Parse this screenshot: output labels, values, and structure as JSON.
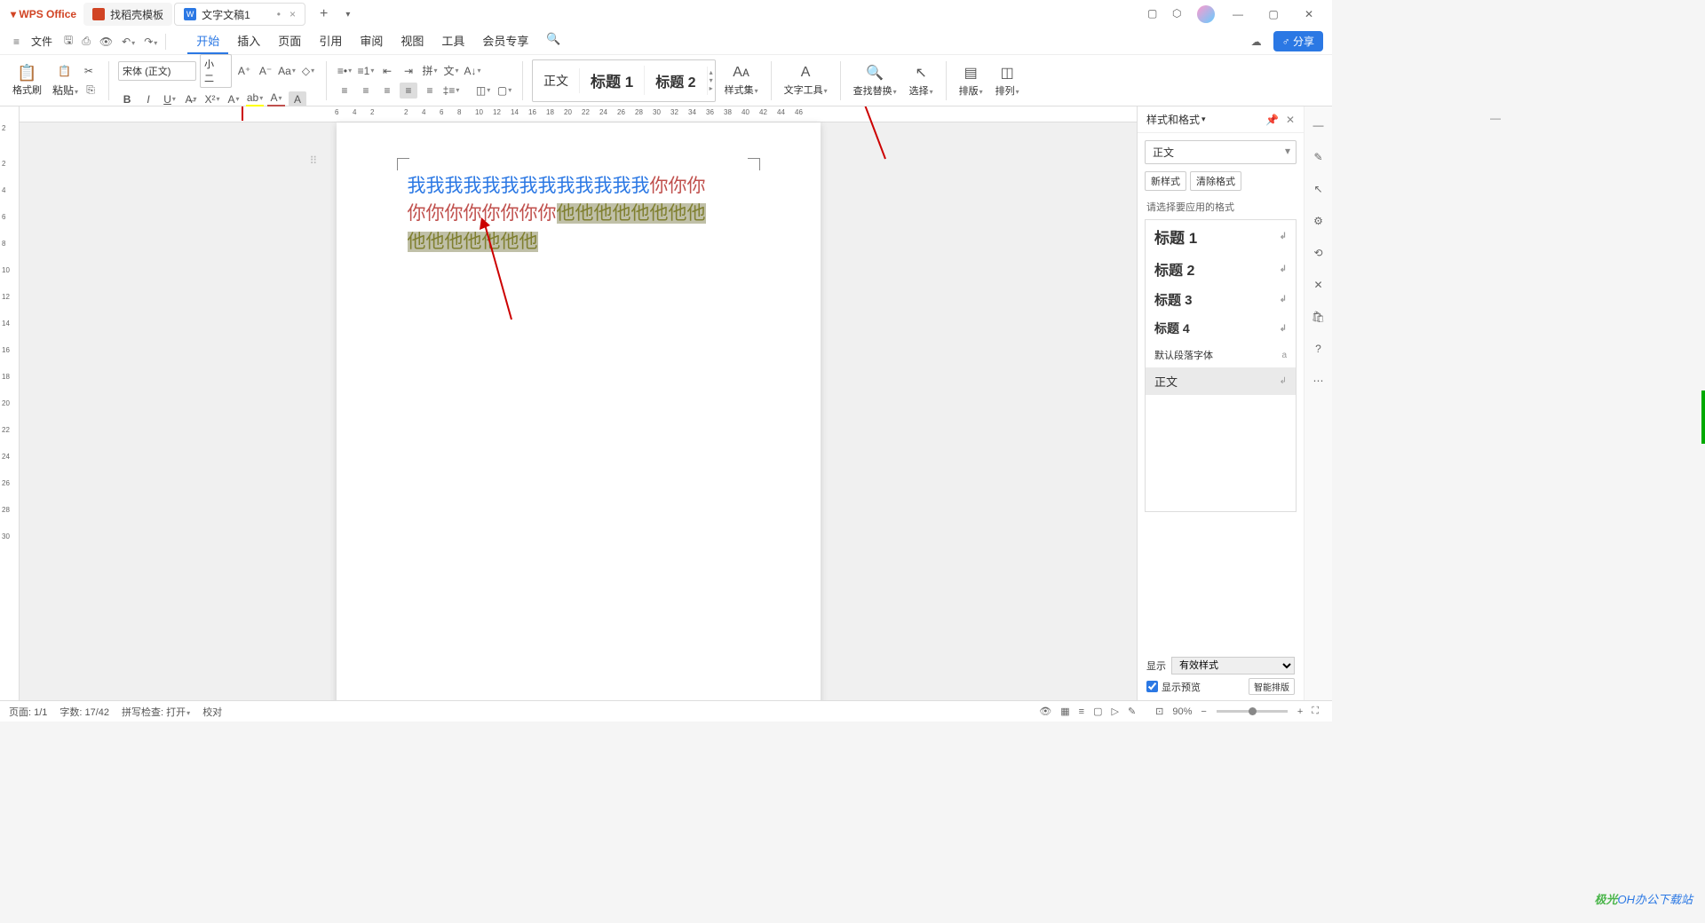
{
  "titlebar": {
    "app_name": "WPS Office",
    "tabs": [
      {
        "label": "找稻壳模板",
        "icon": "red"
      },
      {
        "label": "文字文稿1",
        "icon": "blue",
        "icon_text": "W",
        "modified": true
      }
    ]
  },
  "menu": {
    "file": "文件",
    "tabs": [
      "开始",
      "插入",
      "页面",
      "引用",
      "审阅",
      "视图",
      "工具",
      "会员专享"
    ],
    "active_tab": "开始",
    "share": "分享"
  },
  "ribbon": {
    "format_painter": "格式刷",
    "paste": "粘贴",
    "font_name": "宋体 (正文)",
    "font_size": "小二",
    "style_gallery": [
      "正文",
      "标题 1",
      "标题 2"
    ],
    "styles_btn": "样式集",
    "text_tools": "文字工具",
    "find_replace": "查找替换",
    "select": "选择",
    "layout": "排版",
    "arrange": "排列"
  },
  "hruler_ticks": [
    "6",
    "4",
    "2",
    "",
    "2",
    "4",
    "6",
    "8",
    "10",
    "12",
    "14",
    "16",
    "18",
    "20",
    "22",
    "24",
    "26",
    "28",
    "30",
    "32",
    "34",
    "36",
    "38",
    "40",
    "42",
    "44",
    "46"
  ],
  "vruler_ticks": [
    "2",
    "",
    "2",
    "4",
    "6",
    "8",
    "10",
    "12",
    "14",
    "16",
    "18",
    "20",
    "22",
    "24",
    "26",
    "28",
    "30"
  ],
  "document": {
    "line1_blue": "我我我我我我我我我我我我我",
    "line1_red": "你你你",
    "line2_red": "你你你你你你你你",
    "line2_olive": "他他他他他他他他",
    "line3_olive": "他他他他他他他"
  },
  "styles_panel": {
    "title": "样式和格式",
    "current": "正文",
    "new_style": "新样式",
    "clear_format": "清除格式",
    "prompt": "请选择要应用的格式",
    "items": [
      {
        "label": "标题 1",
        "cls": "h1"
      },
      {
        "label": "标题 2",
        "cls": "h2"
      },
      {
        "label": "标题 3",
        "cls": "h3"
      },
      {
        "label": "标题 4",
        "cls": "h4"
      },
      {
        "label": "默认段落字体",
        "cls": "para",
        "lock": true
      },
      {
        "label": "正文",
        "cls": "sel"
      }
    ],
    "show_label": "显示",
    "show_value": "有效样式",
    "preview_check": "显示预览",
    "smart": "智能排版"
  },
  "statusbar": {
    "page": "页面: 1/1",
    "words": "字数: 17/42",
    "spellcheck": "拼写检查: 打开",
    "proof": "校对",
    "zoom": "90%"
  },
  "watermark": {
    "t1": "极光",
    "t2": "OH办公下载站"
  }
}
